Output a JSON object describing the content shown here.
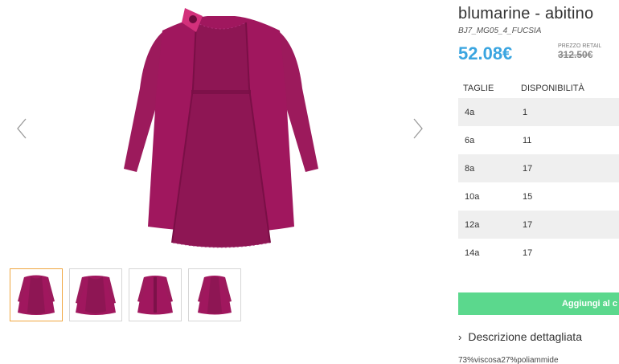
{
  "product": {
    "title": "blumarine - abitino",
    "sku": "BJ7_MG05_4_FUCSIA",
    "price": "52.08€",
    "retail_label": "PREZZO RETAIL",
    "retail_price": "312.50€"
  },
  "sizes_table": {
    "headers": [
      "TAGLIE",
      "DISPONIBILITÀ"
    ],
    "rows": [
      {
        "size": "4a",
        "qty": "1"
      },
      {
        "size": "6a",
        "qty": "11"
      },
      {
        "size": "8a",
        "qty": "17"
      },
      {
        "size": "10a",
        "qty": "15"
      },
      {
        "size": "12a",
        "qty": "17"
      },
      {
        "size": "14a",
        "qty": "17"
      }
    ]
  },
  "actions": {
    "add_label": "Aggiungi al c"
  },
  "description": {
    "toggle_label": "Descrizione dettagliata",
    "chevron": "›",
    "composition": "73%viscosa27%poliammide"
  },
  "gallery": {
    "prev_icon": "chevron-left-icon",
    "next_icon": "chevron-right-icon",
    "thumbnail_count": 4,
    "active_thumbnail": 1
  },
  "colors": {
    "price": "#3aa5e0",
    "button": "#5bd88d",
    "dress": "#a0175e",
    "active_thumb_border": "#f0a640"
  }
}
